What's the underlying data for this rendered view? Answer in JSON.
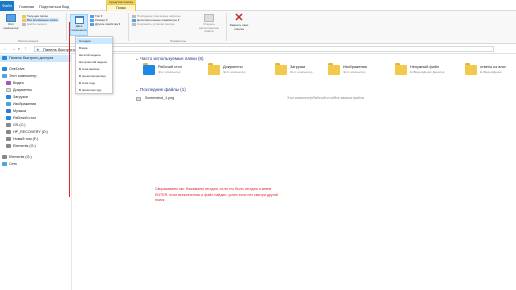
{
  "tabs": {
    "file": "Файл",
    "home": "Главная",
    "share": "Поделиться",
    "view": "Вид",
    "context_header": "Средства поиска",
    "search": "Поиск"
  },
  "ribbon": {
    "this_computer": "Этот компьютер",
    "current_folder": "Текущая папка",
    "all_subfolders": "Все вложенные папки",
    "search_again": "Найти снова в",
    "date_modified": "Дата изменения",
    "kind": "Тип",
    "size": "Размер",
    "other_props": "Другие свойства",
    "recent_searches": "Последние поисковые запросы",
    "advanced_options": "Дополнительные параметры",
    "save_search": "Сохранить условия поиска",
    "open_location": "Открыть расположение файла",
    "close_search": "Закрыть окно поиска",
    "group_location": "Расположение",
    "group_options": "Параметры"
  },
  "dropdown": {
    "items": [
      "Сегодня",
      "Вчера",
      "На этой неделе",
      "На прошлой неделе",
      "В этом месяце",
      "В прошлом месяце",
      "В этом году",
      "В прошлом году"
    ]
  },
  "address": {
    "path": "Панель быстрого доступа"
  },
  "sidebar": {
    "items": [
      {
        "label": "Панель быстрого доступа",
        "color": "#1e88e5"
      },
      {
        "label": "OneDrive",
        "color": "#1e88e5"
      },
      {
        "label": "Этот компьютер",
        "color": "#5aa0e0"
      },
      {
        "label": "Видео",
        "color": "#9b59b6"
      },
      {
        "label": "Документы",
        "color": "#e0e0e0"
      },
      {
        "label": "Загрузки",
        "color": "#1e88e5"
      },
      {
        "label": "Изображения",
        "color": "#4aa3df"
      },
      {
        "label": "Музыка",
        "color": "#2e7bcf"
      },
      {
        "label": "Рабочий стол",
        "color": "#1e88e5"
      },
      {
        "label": "OS (C:)",
        "color": "#888888"
      },
      {
        "label": "HP_RECOVERY (D:)",
        "color": "#888888"
      },
      {
        "label": "Новый том (F:)",
        "color": "#888888"
      },
      {
        "label": "Elements (G:)",
        "color": "#888888"
      },
      {
        "label": "Elements (G:)",
        "color": "#888888"
      },
      {
        "label": "Сеть",
        "color": "#4aa3df"
      }
    ]
  },
  "frequent": {
    "heading": "Часто используемые папки (6)",
    "folders": [
      {
        "name": "Рабочий стол",
        "location": "Этот компьютер"
      },
      {
        "name": "Документы",
        "location": "Этот компьютер"
      },
      {
        "name": "Загрузки",
        "location": "Этот компьютер"
      },
      {
        "name": "Изображения",
        "location": "Этот компьютер"
      },
      {
        "name": "Ненужный файл",
        "location": "E:\\Видео\\Денис Денисов"
      },
      {
        "name": "ответы из альт",
        "location": "E:\\Видео\\Денис"
      }
    ]
  },
  "recent": {
    "heading": "Последние файлы (1)",
    "file_name": "Screenshot_1.png",
    "file_location": "Этот компьютер\\Рабочий стол\\Все важные файлы"
  },
  "annotation": {
    "text": "Сворачиваем так. Нажимаем сегодня, если это было сегодня и жмем ENTER, если выполнялось и файл найден, успех если нет смотри другой поиск"
  }
}
